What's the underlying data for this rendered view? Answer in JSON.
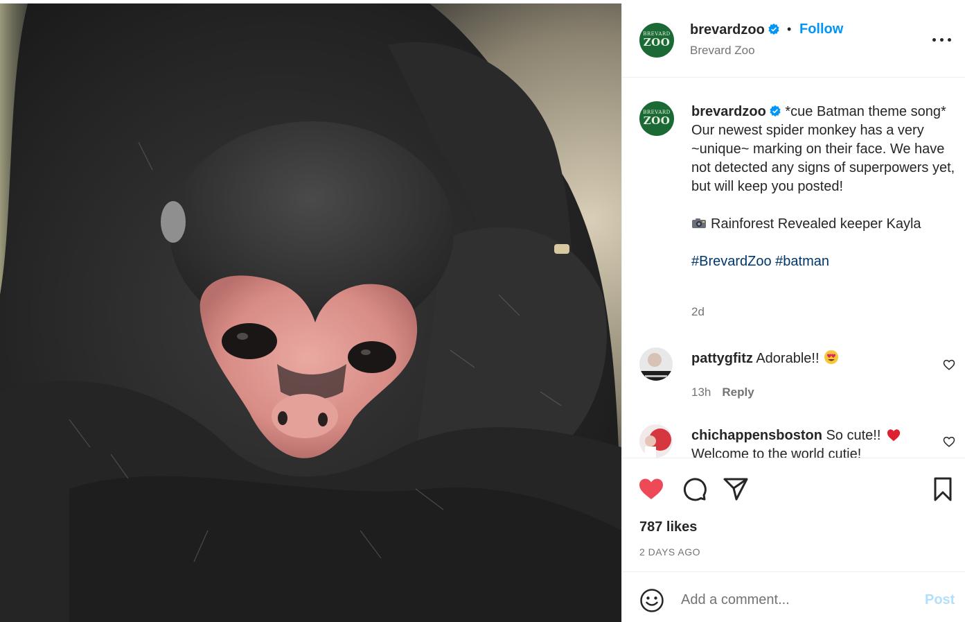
{
  "photo": {
    "alt_icon": "spider-monkey-photo"
  },
  "header": {
    "username": "brevardzoo",
    "separator": "•",
    "follow_label": "Follow",
    "subtitle": "Brevard Zoo",
    "avatar_logo_top": "BREVARD",
    "avatar_logo_bottom": "ZOO",
    "more_icon": "more-options-icon"
  },
  "caption": {
    "username": "brevardzoo",
    "lines": [
      "*cue Batman theme song* Our newest spider monkey has a very ~unique~ marking on their face. We have not detected any signs of superpowers yet, but will keep you posted!"
    ],
    "credit": "Rainforest Revealed keeper Kayla",
    "hashtags": "#BrevardZoo #batman",
    "time": "2d"
  },
  "comments": [
    {
      "username": "pattygfitz",
      "text": "Adorable!!",
      "time": "13h",
      "reply_label": "Reply"
    },
    {
      "username": "chichappensboston",
      "text": "So cute!!",
      "text2": "Welcome to the world cutie!"
    }
  ],
  "actions": {
    "likes": "787 likes",
    "date": "2 DAYS AGO",
    "liked": true
  },
  "add_comment": {
    "placeholder": "Add a comment...",
    "post_label": "Post"
  },
  "colors": {
    "accent": "#0095f6",
    "like_red": "#ed4956",
    "hashtag": "#00376b",
    "zoo_green": "#1b6a35"
  }
}
